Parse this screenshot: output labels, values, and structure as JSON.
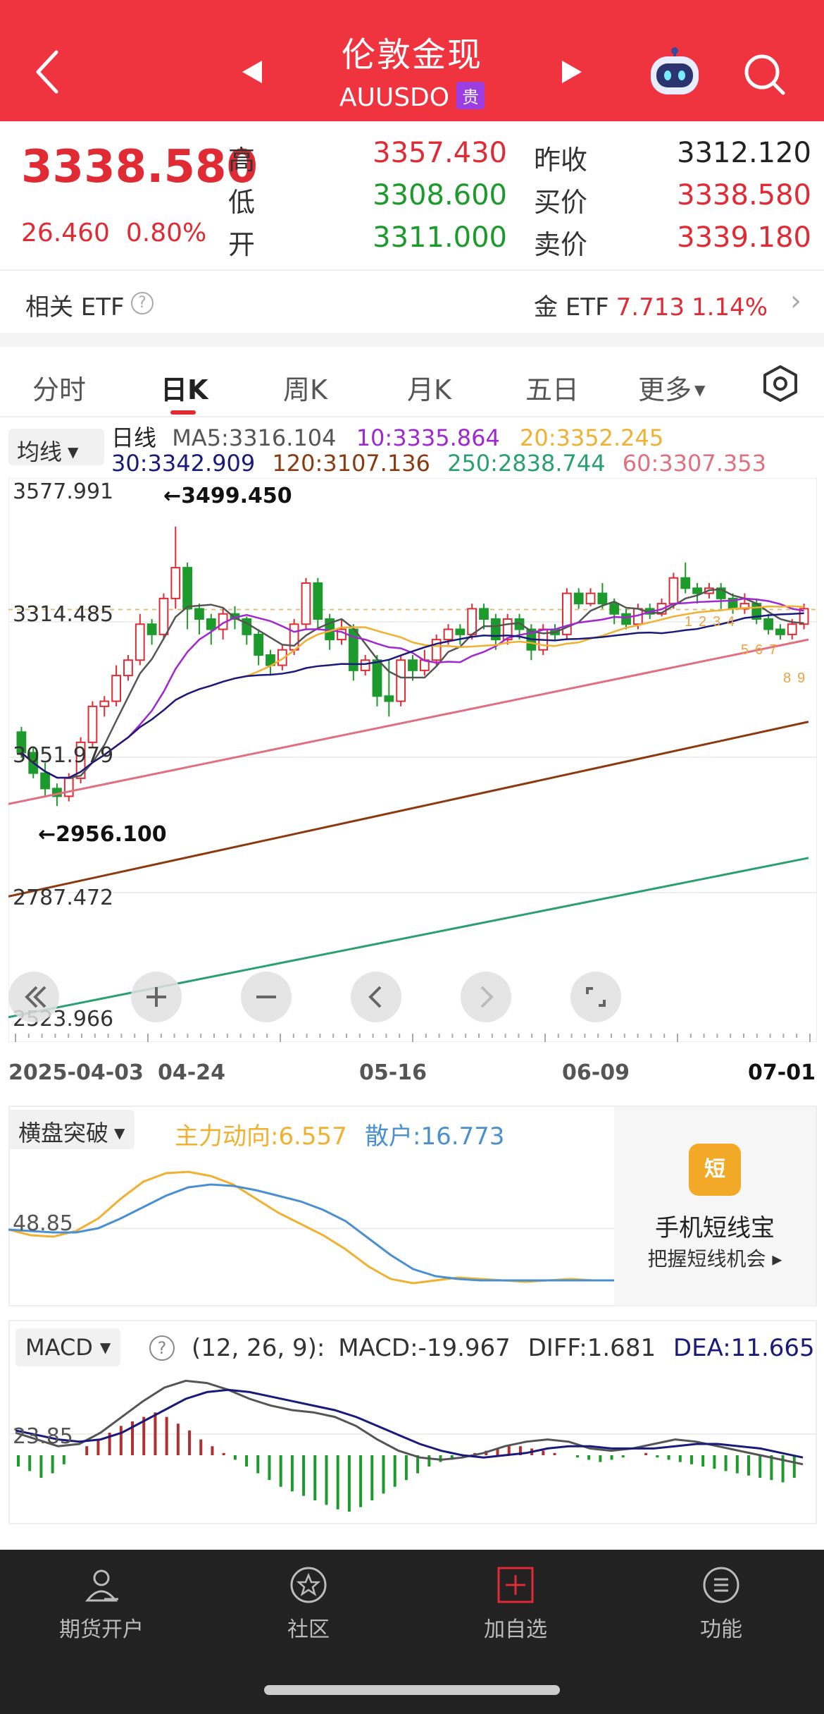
{
  "header": {
    "title": "伦敦金现",
    "symbol": "AUUSDO",
    "badge": "贵"
  },
  "quote": {
    "last": "3338.580",
    "change": "26.460",
    "change_pct": "0.80%",
    "labels": {
      "high": "高",
      "low": "低",
      "open": "开",
      "prev_close": "昨收",
      "bid": "买价",
      "ask": "卖价"
    },
    "high": "3357.430",
    "low": "3308.600",
    "open": "3311.000",
    "prev_close": "3312.120",
    "bid": "3338.580",
    "ask": "3339.180",
    "colors": {
      "up": "#e02b35",
      "down": "#1d9a2c"
    }
  },
  "etf": {
    "label": "相关 ETF",
    "help": "?",
    "name": "金 ETF",
    "value": "7.713",
    "pct": "1.14%"
  },
  "tabs": [
    "分时",
    "日K",
    "周K",
    "月K",
    "五日",
    "更多"
  ],
  "active_tab": "日K",
  "ma": {
    "selector": "均线",
    "title": "日线",
    "ma5": "MA5:3316.104",
    "ma10": "10:3335.864",
    "ma20": "20:3352.245",
    "ma30": "30:3342.909",
    "ma120": "120:3107.136",
    "ma250": "250:2838.744",
    "ma60": "60:3307.353",
    "colors": {
      "ma5": "#555555",
      "ma10": "#a028d0",
      "ma20": "#f0b030",
      "ma30": "#1a1a7a",
      "ma120": "#8b3a10",
      "ma250": "#2aa070",
      "ma60": "#e07080"
    }
  },
  "kchart": {
    "y_labels": [
      "3577.991",
      "3314.485",
      "3051.979",
      "2787.472",
      "2523.966"
    ],
    "high_marker": "←3499.450",
    "low_marker": "←2956.100",
    "x_labels": [
      "2025-04-03",
      "04-24",
      "05-16",
      "06-09",
      "07-01"
    ],
    "step_labels": [
      "1",
      "2",
      "3",
      "4",
      "5",
      "6",
      "7",
      "8",
      "9"
    ],
    "control_icons": [
      "collapse-icon",
      "zoom-in-icon",
      "zoom-out-icon",
      "scroll-left-icon",
      "scroll-right-icon",
      "fullscreen-icon"
    ]
  },
  "chart_data": {
    "type": "candlestick",
    "ylim": [
      2523.966,
      3577.991
    ],
    "x_ticks": [
      "2025-04-03",
      "04-24",
      "05-16",
      "06-09",
      "07-01"
    ],
    "candles": [
      [
        3100,
        3060,
        3110,
        3050
      ],
      [
        3060,
        3020,
        3070,
        3010
      ],
      [
        3020,
        2990,
        3040,
        2975
      ],
      [
        2990,
        2975,
        3000,
        2956
      ],
      [
        2975,
        3010,
        3020,
        2965
      ],
      [
        3010,
        3080,
        3090,
        3000
      ],
      [
        3080,
        3150,
        3160,
        3070
      ],
      [
        3150,
        3160,
        3170,
        3130
      ],
      [
        3160,
        3210,
        3230,
        3150
      ],
      [
        3210,
        3240,
        3250,
        3200
      ],
      [
        3240,
        3310,
        3330,
        3230
      ],
      [
        3310,
        3290,
        3320,
        3270
      ],
      [
        3290,
        3360,
        3370,
        3280
      ],
      [
        3360,
        3420,
        3500,
        3340
      ],
      [
        3420,
        3340,
        3430,
        3300
      ],
      [
        3340,
        3320,
        3350,
        3290
      ],
      [
        3320,
        3300,
        3330,
        3270
      ],
      [
        3300,
        3330,
        3340,
        3280
      ],
      [
        3330,
        3320,
        3345,
        3300
      ],
      [
        3320,
        3290,
        3325,
        3270
      ],
      [
        3290,
        3250,
        3300,
        3230
      ],
      [
        3250,
        3230,
        3260,
        3210
      ],
      [
        3230,
        3260,
        3270,
        3220
      ],
      [
        3260,
        3310,
        3320,
        3250
      ],
      [
        3310,
        3390,
        3400,
        3300
      ],
      [
        3390,
        3320,
        3400,
        3300
      ],
      [
        3320,
        3280,
        3330,
        3260
      ],
      [
        3280,
        3300,
        3320,
        3270
      ],
      [
        3300,
        3220,
        3310,
        3200
      ],
      [
        3220,
        3240,
        3250,
        3210
      ],
      [
        3240,
        3170,
        3250,
        3150
      ],
      [
        3170,
        3160,
        3240,
        3130
      ],
      [
        3160,
        3240,
        3250,
        3150
      ],
      [
        3240,
        3220,
        3250,
        3200
      ],
      [
        3220,
        3240,
        3260,
        3210
      ],
      [
        3240,
        3280,
        3290,
        3230
      ],
      [
        3280,
        3300,
        3310,
        3270
      ],
      [
        3300,
        3290,
        3310,
        3270
      ],
      [
        3290,
        3340,
        3350,
        3280
      ],
      [
        3340,
        3320,
        3350,
        3300
      ],
      [
        3320,
        3280,
        3330,
        3260
      ],
      [
        3280,
        3320,
        3330,
        3270
      ],
      [
        3320,
        3300,
        3330,
        3280
      ],
      [
        3300,
        3260,
        3310,
        3240
      ],
      [
        3260,
        3300,
        3310,
        3250
      ],
      [
        3300,
        3290,
        3310,
        3280
      ],
      [
        3290,
        3370,
        3380,
        3280
      ],
      [
        3370,
        3350,
        3380,
        3340
      ],
      [
        3350,
        3370,
        3380,
        3345
      ],
      [
        3370,
        3350,
        3390,
        3340
      ],
      [
        3350,
        3330,
        3360,
        3310
      ],
      [
        3330,
        3310,
        3340,
        3300
      ],
      [
        3310,
        3340,
        3350,
        3300
      ],
      [
        3340,
        3330,
        3350,
        3320
      ],
      [
        3330,
        3350,
        3360,
        3325
      ],
      [
        3350,
        3400,
        3410,
        3340
      ],
      [
        3400,
        3380,
        3430,
        3370
      ],
      [
        3380,
        3370,
        3390,
        3350
      ],
      [
        3370,
        3380,
        3390,
        3360
      ],
      [
        3380,
        3360,
        3390,
        3340
      ],
      [
        3360,
        3340,
        3370,
        3330
      ],
      [
        3340,
        3350,
        3370,
        3330
      ],
      [
        3350,
        3320,
        3360,
        3310
      ],
      [
        3320,
        3300,
        3330,
        3290
      ],
      [
        3300,
        3290,
        3310,
        3280
      ],
      [
        3290,
        3310,
        3320,
        3280
      ],
      [
        3310,
        3340,
        3350,
        3300
      ]
    ],
    "indicator": {
      "selector": "横盘突破",
      "main_label": "主力动向:6.557",
      "retail_label": "散户:16.773",
      "y_label": "48.85",
      "main": [
        48,
        44,
        43,
        47,
        56,
        70,
        82,
        88,
        89,
        86,
        80,
        70,
        60,
        52,
        44,
        34,
        22,
        13,
        10,
        12,
        14,
        13,
        12,
        11,
        12,
        13,
        12,
        12
      ],
      "retail": [
        48,
        47,
        46,
        46,
        49,
        56,
        64,
        72,
        78,
        80,
        79,
        76,
        72,
        68,
        62,
        54,
        42,
        30,
        20,
        15,
        13,
        12,
        12,
        12,
        12,
        12,
        12,
        12
      ]
    },
    "macd": {
      "selector": "MACD",
      "params": "(12, 26, 9):",
      "macd": "MACD:-19.967",
      "diff": "DIFF:1.681",
      "dea": "DEA:11.665",
      "y_label": "23.85",
      "hist": [
        -10,
        -14,
        -20,
        -16,
        -8,
        0,
        8,
        14,
        20,
        26,
        30,
        34,
        38,
        34,
        28,
        22,
        14,
        8,
        2,
        -4,
        -10,
        -16,
        -22,
        -28,
        -32,
        -36,
        -40,
        -44,
        -48,
        -50,
        -46,
        -40,
        -34,
        -28,
        -22,
        -16,
        -10,
        -6,
        -4,
        -2,
        2,
        4,
        6,
        8,
        8,
        6,
        4,
        2,
        0,
        -2,
        -4,
        -6,
        -4,
        -2,
        0,
        2,
        -2,
        -4,
        -6,
        -8,
        -10,
        -12,
        -14,
        -16,
        -18,
        -20,
        -22,
        -24,
        -20
      ],
      "diff_line": [
        20,
        14,
        8,
        10,
        20,
        34,
        48,
        60,
        66,
        64,
        58,
        50,
        44,
        40,
        38,
        34,
        26,
        14,
        4,
        -2,
        -4,
        -2,
        2,
        8,
        12,
        14,
        12,
        6,
        4,
        6,
        10,
        14,
        12,
        8,
        4,
        0,
        -4,
        -8
      ],
      "dea_line": [
        22,
        18,
        14,
        12,
        14,
        20,
        30,
        40,
        50,
        56,
        58,
        56,
        52,
        48,
        44,
        40,
        34,
        26,
        18,
        10,
        4,
        0,
        -2,
        0,
        2,
        6,
        8,
        8,
        6,
        6,
        6,
        8,
        10,
        10,
        8,
        6,
        2,
        -2
      ]
    }
  },
  "bottom_nav": [
    {
      "label": "期货开户",
      "icon": "user-card-icon"
    },
    {
      "label": "社区",
      "icon": "community-icon"
    },
    {
      "label": "加自选",
      "icon": "add-favorite-icon"
    },
    {
      "label": "功能",
      "icon": "menu-icon"
    }
  ],
  "promo": {
    "icon_text": "短",
    "title": "手机短线宝",
    "subtitle": "把握短线机会 ▸"
  }
}
